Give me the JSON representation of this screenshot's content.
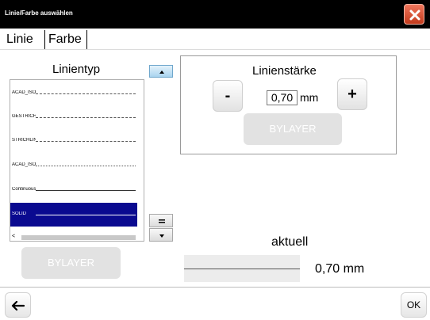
{
  "window": {
    "title": "Linie/Farbe auswählen",
    "close_icon": "close-icon",
    "close_color": "#d9532f"
  },
  "tabs": [
    {
      "label": "Linie"
    },
    {
      "label": "Farbe"
    }
  ],
  "linetype": {
    "label": "Linientyp",
    "items": [
      {
        "name": "ACAD_ISO"
      },
      {
        "name": "GESTRICHELT"
      },
      {
        "name": "STRICHLINIE"
      },
      {
        "name": "ACAD_ISO"
      },
      {
        "name": "Continuous"
      },
      {
        "name": "SOLID"
      }
    ],
    "selected": "SOLID",
    "selection_color": "#0a0a90",
    "scroll_left_glyph": "<",
    "bylayer_label": "BYLAYER",
    "scroll_up_icon": "triangle-up-icon",
    "scroll_mid_icon": "equals-icon",
    "scroll_down_icon": "triangle-down-icon"
  },
  "lineweight": {
    "label": "Linienstärke",
    "minus_label": "-",
    "plus_label": "+",
    "value": "0,70",
    "unit": "mm",
    "bylayer_label": "BYLAYER"
  },
  "current": {
    "label": "aktuell",
    "value": "0,70 mm"
  },
  "footer": {
    "back_icon": "arrow-left-icon",
    "ok_label": "OK"
  }
}
